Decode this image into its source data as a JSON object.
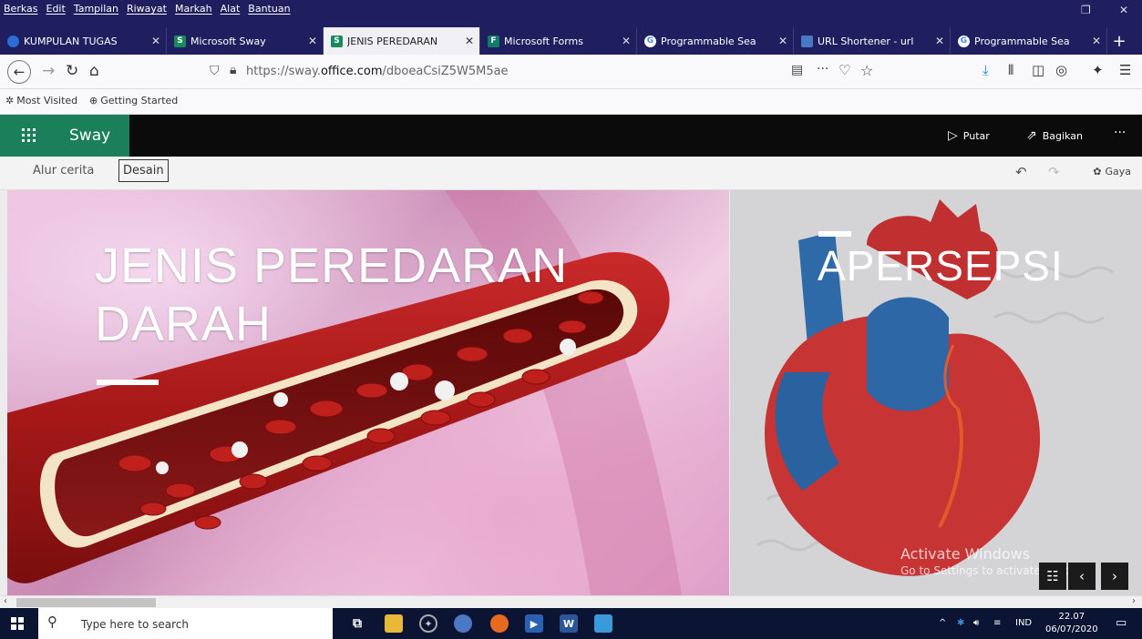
{
  "menubar": {
    "items": [
      "Berkas",
      "Edit",
      "Tampilan",
      "Riwayat",
      "Markah",
      "Alat",
      "Bantuan"
    ]
  },
  "tabs": [
    {
      "label": "KUMPULAN TUGAS",
      "icon": "onedrive-icon",
      "active": false
    },
    {
      "label": "Microsoft Sway",
      "icon": "sway-icon",
      "active": false
    },
    {
      "label": "JENIS PEREDARAN",
      "icon": "sway-icon",
      "active": true
    },
    {
      "label": "Microsoft Forms",
      "icon": "forms-icon",
      "active": false
    },
    {
      "label": "Programmable Sea",
      "icon": "google-icon",
      "active": false
    },
    {
      "label": "URL Shortener - url",
      "icon": "url-shortener-icon",
      "active": false
    },
    {
      "label": "Programmable Sea",
      "icon": "google-icon",
      "active": false
    }
  ],
  "navbar": {
    "url_prefix": "https://sway.",
    "url_domain": "office.com",
    "url_path": "/dboeaCsiZ5W5M5ae"
  },
  "bookmarks": [
    {
      "label": "Most Visited",
      "icon": "gear-icon"
    },
    {
      "label": "Getting Started",
      "icon": "globe-icon"
    }
  ],
  "sway": {
    "app_name": "Sway",
    "play_label": "Putar",
    "share_label": "Bagikan",
    "more_label": "···",
    "tab_storyline": "Alur cerita",
    "tab_design": "Desain",
    "style_label": "Gaya"
  },
  "content": {
    "left_title_line1": "JENIS PEREDARAN",
    "left_title_line2": "DARAH",
    "right_title": "APERSEPSI"
  },
  "watermark": {
    "line1": "Activate Windows",
    "line2": "Go to Settings to activate Windows."
  },
  "taskbar": {
    "search_placeholder": "Type here to search",
    "language": "IND",
    "time": "22.07",
    "date": "06/07/2020"
  },
  "colors": {
    "firefox_chrome": "#1f1f60",
    "sway_green": "#1a7f5a",
    "sway_header": "#0b0b0b",
    "taskbar": "#0c1433"
  }
}
